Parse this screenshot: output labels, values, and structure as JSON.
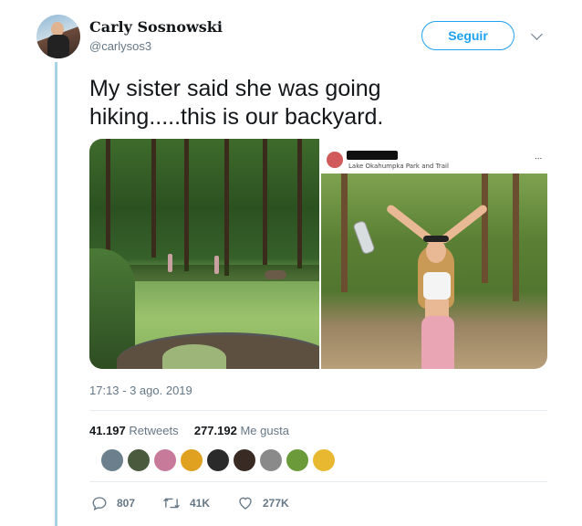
{
  "tweet": {
    "display_name": "Carly Sosnowski",
    "handle": "@carlysos3",
    "follow_label": "Seguir",
    "text": "My sister said she was going hiking.....this is our backyard.",
    "timestamp": "17:13 - 3 ago. 2019"
  },
  "media": {
    "right_photo": {
      "location": "Lake Okahumpka Park and Trail",
      "more": "..."
    }
  },
  "stats": {
    "retweets_count": "41.197",
    "retweets_label": "Retweets",
    "likes_count": "277.192",
    "likes_label": "Me gusta"
  },
  "likers": [
    {
      "color": "#6b7f8c"
    },
    {
      "color": "#4a5a3c"
    },
    {
      "color": "#c87a9a"
    },
    {
      "color": "#e0a020"
    },
    {
      "color": "#2a2a2a"
    },
    {
      "color": "#3a2a24"
    },
    {
      "color": "#8a8a8a"
    },
    {
      "color": "#6a9a3a"
    },
    {
      "color": "#e8b830"
    }
  ],
  "actions": {
    "reply_count": "807",
    "retweet_count": "41K",
    "like_count": "277K"
  },
  "colors": {
    "accent": "#1da1f2",
    "secondary_text": "#657786",
    "thread_line": "#a6d3e8"
  },
  "icons": [
    "avatar",
    "chevron-down-icon",
    "reply-icon",
    "retweet-icon",
    "heart-icon",
    "more-icon",
    "emoji-icon"
  ]
}
